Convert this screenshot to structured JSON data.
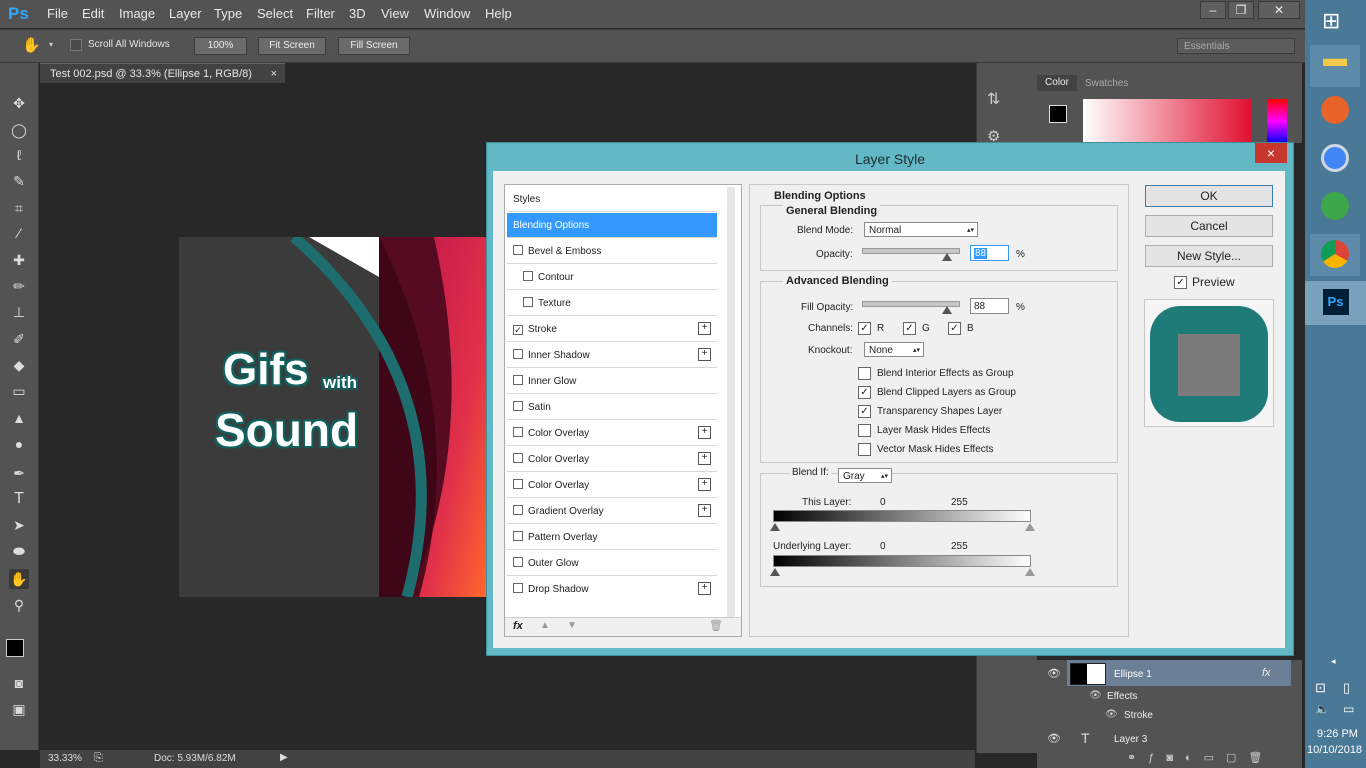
{
  "app": {
    "logo": "Ps"
  },
  "menu": [
    "File",
    "Edit",
    "Image",
    "Layer",
    "Type",
    "Select",
    "Filter",
    "3D",
    "View",
    "Window",
    "Help"
  ],
  "options_bar": {
    "scroll_all": "Scroll All Windows",
    "zoom_btn": "100%",
    "fit_btn": "Fit Screen",
    "fill_btn": "Fill Screen",
    "workspace": "Essentials"
  },
  "document": {
    "tab_title": "Test 002.psd @ 33.3% (Ellipse 1, RGB/8)",
    "close": "×",
    "canvas_text_1": "Gifs",
    "canvas_text_2": "with",
    "canvas_text_3": "Sound"
  },
  "status": {
    "zoom": "33.33%",
    "doc": "Doc: 5.93M/6.82M"
  },
  "panels": {
    "color_tab": "Color",
    "swatches_tab": "Swatches"
  },
  "layers": [
    {
      "name": "Ellipse 1",
      "fx": "fx"
    },
    {
      "name": "Effects"
    },
    {
      "name": "Stroke"
    },
    {
      "name": "Layer 3"
    }
  ],
  "taskbar": {
    "time": "9:26 PM",
    "date": "10/10/2018"
  },
  "dialog": {
    "title": "Layer Style",
    "close": "×",
    "styles_header": "Styles",
    "styles": [
      {
        "label": "Blending Options",
        "checkbox": false,
        "plus": false,
        "indent": false,
        "selected": true,
        "checked": false
      },
      {
        "label": "Bevel & Emboss",
        "checkbox": true,
        "plus": false,
        "indent": false,
        "checked": false
      },
      {
        "label": "Contour",
        "checkbox": true,
        "plus": false,
        "indent": true,
        "checked": false
      },
      {
        "label": "Texture",
        "checkbox": true,
        "plus": false,
        "indent": true,
        "checked": false
      },
      {
        "label": "Stroke",
        "checkbox": true,
        "plus": true,
        "indent": false,
        "checked": true
      },
      {
        "label": "Inner Shadow",
        "checkbox": true,
        "plus": true,
        "indent": false,
        "checked": false
      },
      {
        "label": "Inner Glow",
        "checkbox": true,
        "plus": false,
        "indent": false,
        "checked": false
      },
      {
        "label": "Satin",
        "checkbox": true,
        "plus": false,
        "indent": false,
        "checked": false
      },
      {
        "label": "Color Overlay",
        "checkbox": true,
        "plus": true,
        "indent": false,
        "checked": false
      },
      {
        "label": "Color Overlay",
        "checkbox": true,
        "plus": true,
        "indent": false,
        "checked": false
      },
      {
        "label": "Color Overlay",
        "checkbox": true,
        "plus": true,
        "indent": false,
        "checked": false
      },
      {
        "label": "Gradient Overlay",
        "checkbox": true,
        "plus": true,
        "indent": false,
        "checked": false
      },
      {
        "label": "Pattern Overlay",
        "checkbox": true,
        "plus": false,
        "indent": false,
        "checked": false
      },
      {
        "label": "Outer Glow",
        "checkbox": true,
        "plus": false,
        "indent": false,
        "checked": false
      },
      {
        "label": "Drop Shadow",
        "checkbox": true,
        "plus": true,
        "indent": false,
        "checked": false
      }
    ],
    "fx_label": "fx",
    "blending": {
      "title": "Blending Options",
      "general_title": "General Blending",
      "blend_mode_label": "Blend Mode:",
      "blend_mode_value": "Normal",
      "opacity_label": "Opacity:",
      "opacity_value": "88",
      "percent": "%",
      "advanced_title": "Advanced Blending",
      "fill_opacity_label": "Fill Opacity:",
      "fill_opacity_value": "88",
      "channels_label": "Channels:",
      "channel_r": "R",
      "channel_g": "G",
      "channel_b": "B",
      "knockout_label": "Knockout:",
      "knockout_value": "None",
      "options": [
        {
          "label": "Blend Interior Effects as Group",
          "checked": false
        },
        {
          "label": "Blend Clipped Layers as Group",
          "checked": true
        },
        {
          "label": "Transparency Shapes Layer",
          "checked": true
        },
        {
          "label": "Layer Mask Hides Effects",
          "checked": false
        },
        {
          "label": "Vector Mask Hides Effects",
          "checked": false
        }
      ],
      "blend_if_label": "Blend If:",
      "blend_if_value": "Gray",
      "this_layer_label": "This Layer:",
      "this_layer_min": "0",
      "this_layer_max": "255",
      "underlying_label": "Underlying Layer:",
      "underlying_min": "0",
      "underlying_max": "255"
    },
    "buttons": {
      "ok": "OK",
      "cancel": "Cancel",
      "new_style": "New Style...",
      "preview": "Preview"
    },
    "colors": {
      "title_bar": "#63b8c5",
      "selected_item": "#3399ff",
      "preview_shape": "#1e7b78"
    }
  }
}
